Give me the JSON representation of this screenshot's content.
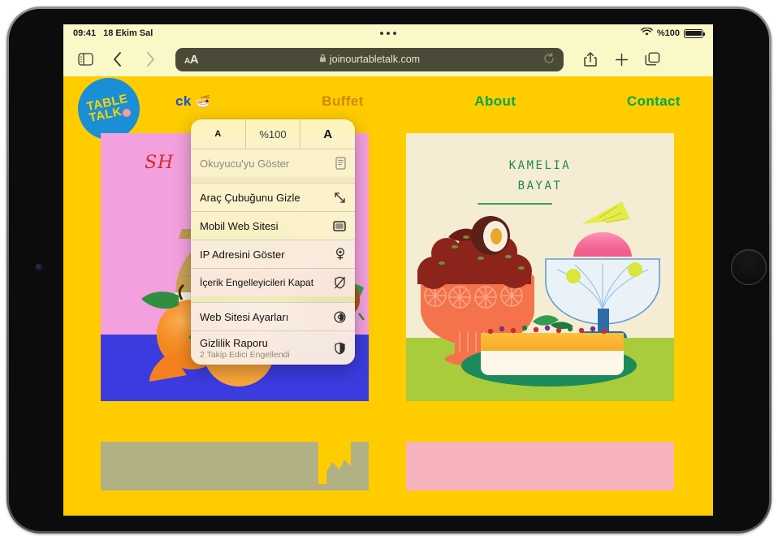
{
  "status_bar": {
    "time": "09:41",
    "date": "18 Ekim Sal",
    "wifi_icon": "wifi-icon",
    "battery_text": "%100",
    "battery_icon": "battery-full-icon",
    "multitask_icon": "multitasking-dots-icon"
  },
  "toolbar": {
    "sidebar_icon": "sidebar-icon",
    "back_icon": "chevron-left-icon",
    "forward_icon": "chevron-right-icon",
    "aa_small": "A",
    "aa_large": "A",
    "lock_icon": "lock-icon",
    "url": "joinourtabletalk.com",
    "reload_icon": "reload-icon",
    "share_icon": "share-icon",
    "new_tab_icon": "plus-icon",
    "tabs_icon": "tabs-icon"
  },
  "aa_menu": {
    "zoom_out_label": "A",
    "zoom_level": "%100",
    "zoom_in_label": "A",
    "items": [
      {
        "label": "Okuyucu'yu Göster",
        "icon": "reader-icon",
        "dim": true,
        "sub": ""
      },
      {
        "label": "Araç Çubuğunu Gizle",
        "icon": "expand-arrows-icon",
        "dim": false,
        "sub": ""
      },
      {
        "label": "Mobil Web Sitesi",
        "icon": "desktop-window-icon",
        "dim": false,
        "sub": ""
      },
      {
        "label": "IP Adresini Göster",
        "icon": "location-pin-icon",
        "dim": false,
        "sub": ""
      },
      {
        "label": "İçerik Engelleyicileri Kapat",
        "icon": "shield-slash-icon",
        "dim": false,
        "sub": ""
      },
      {
        "label": "Web Sitesi Ayarları",
        "icon": "settings-gear-circle-icon",
        "dim": false,
        "sub": ""
      },
      {
        "label": "Gizlilik Raporu",
        "icon": "privacy-shield-icon",
        "dim": false,
        "sub": "2 Takip Edici Engellendi"
      }
    ]
  },
  "site": {
    "logo": {
      "line1": "TABLE",
      "line2": "TALK",
      "dot": "logo-dot",
      "bg_color": "#1a8fd6",
      "text_color": "#ffd400"
    },
    "nav": [
      {
        "label": "ck",
        "emoji": "🍜",
        "color": "#1a4fd6"
      },
      {
        "label": "Buffet",
        "emoji": "",
        "color": "#c98a00"
      },
      {
        "label": "About",
        "emoji": "",
        "color": "#00a650"
      },
      {
        "label": "Contact",
        "emoji": "",
        "color": "#00a650"
      }
    ],
    "cards": [
      {
        "name": "still-life-fruit-card",
        "caption": "SH",
        "caption_color": "#d32b2b",
        "bg_color": "#f4a0de",
        "table_color": "#3b3bdf"
      },
      {
        "name": "kamelia-bayat-card",
        "caption_line1": "KAMELIA",
        "caption_line2": "BAYAT",
        "caption_color": "#1f8a4c",
        "bg_color": "#f5ecd4",
        "table_color": "#a8cc3c"
      }
    ],
    "cards_row2": [
      {
        "name": "card-stub-olive",
        "bg_color": "#b2b183"
      },
      {
        "name": "card-stub-pink",
        "bg_color": "#f7b3bd"
      }
    ],
    "page_bg": "#ffcc00"
  }
}
